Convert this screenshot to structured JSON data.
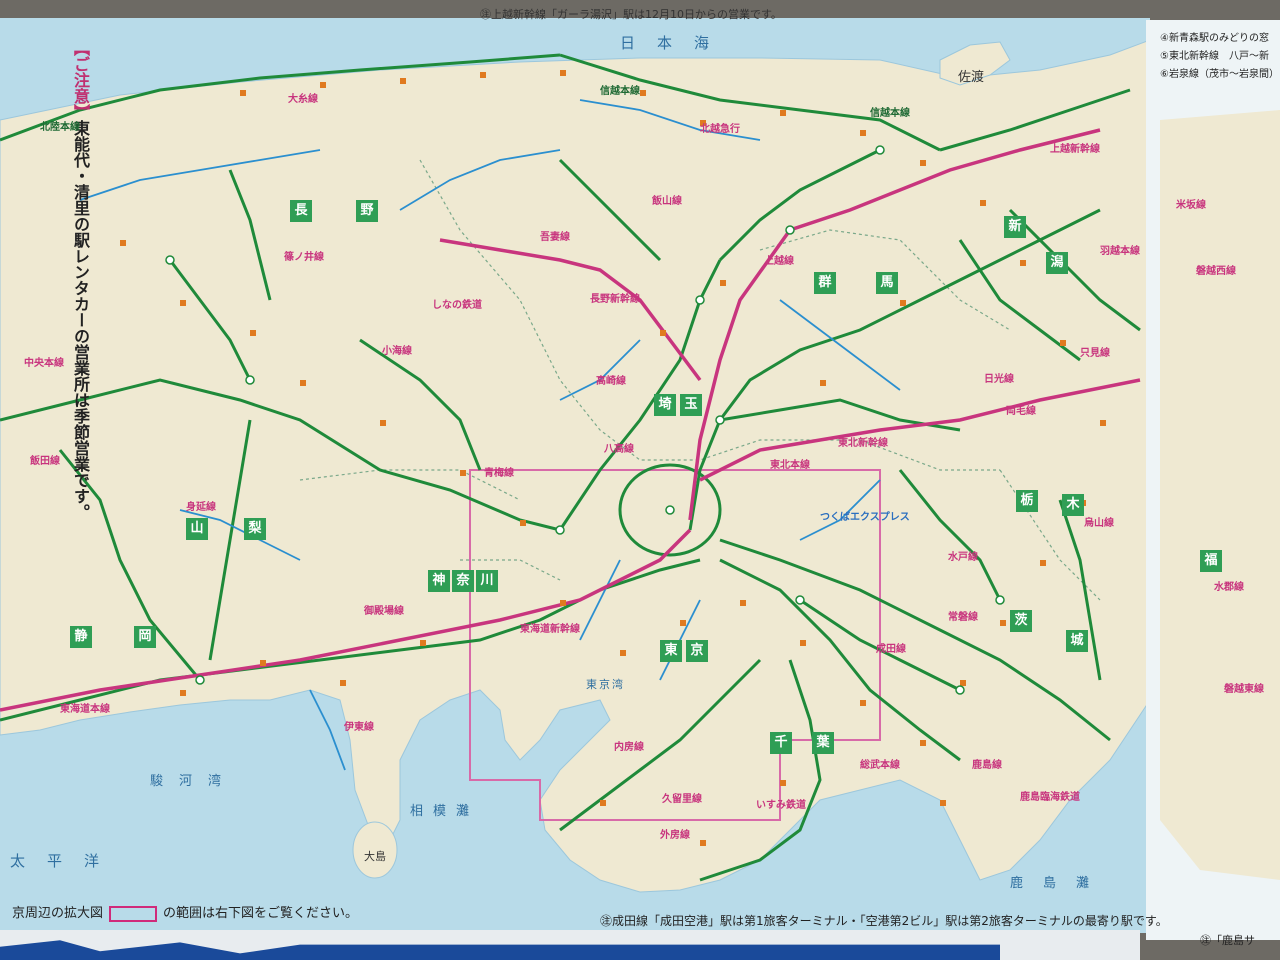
{
  "notes": {
    "top": "㊟上越新幹線「ガーラ湯沢」駅は12月10日からの営業です。",
    "side_bracket": "【ご注意】",
    "side_text": "東能代・清里の駅レンタカーの営業所は季節営業です。",
    "bottom_left_prefix": "京周辺の拡大図",
    "bottom_left_suffix": "の範囲は右下図をご覧ください。",
    "bottom_right": "㊟成田線「成田空港」駅は第1旅客ターミナル・「空港第2ビル」駅は第2旅客ターミナルの最寄り駅です。",
    "right_page_bottom": "㊟「鹿島サ"
  },
  "seas": {
    "japan_sea": "日本海",
    "pacific": "太平洋",
    "suruga_bay": "駿河湾",
    "sagami_bay": "相模灘",
    "tokyo_bay": "東京湾",
    "kashimanada": "鹿島灘"
  },
  "prefectures": [
    {
      "name": "長野",
      "chars": [
        "長",
        "野"
      ]
    },
    {
      "name": "新潟",
      "chars": [
        "新",
        "潟"
      ]
    },
    {
      "name": "群馬",
      "chars": [
        "群",
        "馬"
      ]
    },
    {
      "name": "埼玉",
      "chars": [
        "埼",
        "玉"
      ]
    },
    {
      "name": "山梨",
      "chars": [
        "山",
        "梨"
      ]
    },
    {
      "name": "神奈川",
      "chars": [
        "神",
        "奈",
        "川"
      ]
    },
    {
      "name": "静岡",
      "chars": [
        "静",
        "岡"
      ]
    },
    {
      "name": "東京",
      "chars": [
        "東",
        "京"
      ]
    },
    {
      "name": "千葉",
      "chars": [
        "千",
        "葉"
      ]
    },
    {
      "name": "茨城",
      "chars": [
        "茨",
        "城"
      ]
    },
    {
      "name": "栃木",
      "chars": [
        "栃",
        "木"
      ]
    },
    {
      "name": "福島",
      "chars": [
        "福"
      ]
    }
  ],
  "line_labels": [
    "北陸本線",
    "信越本線",
    "上越新幹線",
    "長野新幹線",
    "中央本線",
    "飯田線",
    "身延線",
    "東海道本線",
    "東海道新幹線",
    "高崎線",
    "東北本線",
    "東北新幹線",
    "常磐線",
    "成田線",
    "総武本線",
    "内房線",
    "外房線",
    "久留里線",
    "鹿島線",
    "水戸線",
    "両毛線",
    "日光線",
    "小海線",
    "篠ノ井線",
    "大糸線",
    "飯山線",
    "吾妻線",
    "烏山線",
    "水郡線",
    "只見線",
    "磐越西線",
    "磐越東線",
    "伊東線",
    "御殿場線",
    "青梅線",
    "八高線",
    "しなの鉄道",
    "つくばエクスプレス",
    "いすみ鉄道",
    "鹿島臨海鉄道",
    "北越急行",
    "信越本線",
    "上越線",
    "米坂線",
    "羽越本線"
  ],
  "islands": {
    "sado": "佐渡",
    "oshima": "大島"
  },
  "right_page_legend": [
    "④新青森駅のみどりの窓",
    "⑤東北新幹線　八戸〜新",
    "⑥岩泉線（茂市〜岩泉間）"
  ],
  "colors": {
    "land": "#efe9d2",
    "sea": "#b8dbe9",
    "jr_line": "#1f8a3a",
    "shinkansen": "#c8357e",
    "private_line": "#2b8fcf",
    "prefecture_badge": "#2f9e55",
    "rental_marker": "#e07a1f"
  }
}
